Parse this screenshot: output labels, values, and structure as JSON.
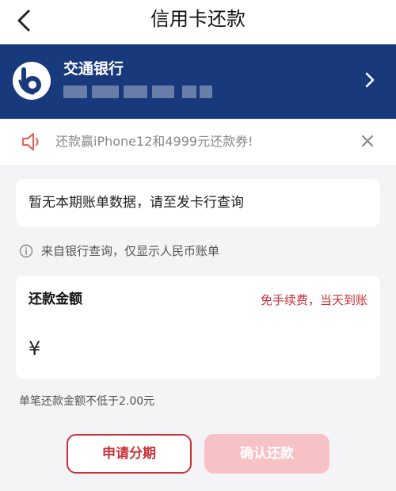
{
  "nav": {
    "title": "信用卡还款"
  },
  "bank": {
    "name": "交通银行"
  },
  "promo": {
    "text": "还款赢iPhone12和4999元还款券!"
  },
  "bill": {
    "message": "暂无本期账单数据，请至发卡行查询"
  },
  "source": {
    "text": "来自银行查询，仅显示人民币账单"
  },
  "repayment": {
    "label": "还款金额",
    "note": "免手续费，当天到账",
    "currency": "¥",
    "value": ""
  },
  "min_note": "单笔还款金额不低于2.00元",
  "actions": {
    "installment_label": "申请分期",
    "confirm_label": "确认还款"
  },
  "colors": {
    "bank_blue": "#18397c",
    "accent_red": "#c8323a",
    "disabled_pink": "#f6c2c6"
  }
}
